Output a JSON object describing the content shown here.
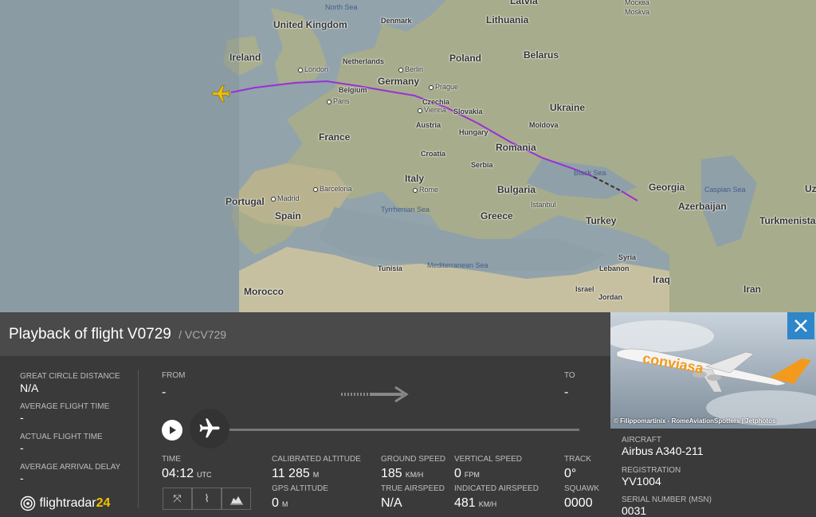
{
  "map": {
    "countries": [
      "United Kingdom",
      "Ireland",
      "France",
      "Portugal",
      "Spain",
      "Morocco",
      "Netherlands",
      "Belgium",
      "Germany",
      "Denmark",
      "Poland",
      "Czechia",
      "Austria",
      "Slovakia",
      "Hungary",
      "Croatia",
      "Serbia",
      "Italy",
      "Romania",
      "Bulgaria",
      "Moldova",
      "Ukraine",
      "Belarus",
      "Lithuania",
      "Latvia",
      "Greece",
      "Turkey",
      "Georgia",
      "Azerbaijan",
      "Turkmenista",
      "Syria",
      "Lebanon",
      "Israel",
      "Jordan",
      "Iraq",
      "Iran",
      "Tunisia",
      "Uz"
    ],
    "cities": [
      "London",
      "Paris",
      "Berlin",
      "Prague",
      "Vienna",
      "Madrid",
      "Barcelona",
      "Rome",
      "Istanbul",
      "Moskva"
    ],
    "city_sub": {
      "Moskva": "Москва"
    },
    "seas": [
      "North Sea",
      "Black Sea",
      "Caspian Sea",
      "Tyrrhenian Sea",
      "Mediterranean Sea"
    ]
  },
  "flight": {
    "title_prefix": "Playback of flight",
    "flight_number": "V0729",
    "callsign": "/ VCV729"
  },
  "stats": {
    "great_circle_distance_label": "GREAT CIRCLE DISTANCE",
    "great_circle_distance": "N/A",
    "average_flight_time_label": "AVERAGE FLIGHT TIME",
    "average_flight_time": "-",
    "actual_flight_time_label": "ACTUAL FLIGHT TIME",
    "actual_flight_time": "-",
    "average_arrival_delay_label": "AVERAGE ARRIVAL DELAY",
    "average_arrival_delay": "-"
  },
  "route": {
    "from_label": "FROM",
    "from": "-",
    "to_label": "TO",
    "to": "-"
  },
  "telemetry": {
    "time_label": "TIME",
    "time": "04:12",
    "time_unit": "UTC",
    "cal_alt_label": "CALIBRATED ALTITUDE",
    "cal_alt": "11 285",
    "cal_alt_unit": "M",
    "gps_alt_label": "GPS ALTITUDE",
    "gps_alt": "0",
    "gps_alt_unit": "M",
    "ground_speed_label": "GROUND SPEED",
    "ground_speed": "185",
    "ground_speed_unit": "KM/H",
    "true_airspeed_label": "TRUE AIRSPEED",
    "true_airspeed": "N/A",
    "vertical_speed_label": "VERTICAL SPEED",
    "vertical_speed": "0",
    "vertical_speed_unit": "FPM",
    "indicated_airspeed_label": "INDICATED AIRSPEED",
    "indicated_airspeed": "481",
    "indicated_airspeed_unit": "KM/H",
    "track_label": "TRACK",
    "track": "0°",
    "squawk_label": "SQUAWK",
    "squawk": "0000"
  },
  "aircraft": {
    "photo_credit": "© Filippomartinix - RomeAviationSpotters | Jetphotos",
    "livery_text": "conviasa",
    "aircraft_label": "AIRCRAFT",
    "aircraft": "Airbus A340-211",
    "registration_label": "REGISTRATION",
    "registration": "YV1004",
    "serial_label": "SERIAL NUMBER (MSN)",
    "serial": "0031"
  },
  "brand": {
    "name_main": "flightradar",
    "name_num": "24"
  },
  "colors": {
    "track": "#9b2fd6",
    "plane": "#f2c200",
    "accent": "#2f86c9",
    "panel": "#3a3a3a"
  },
  "icons": [
    "play-icon",
    "airplane-icon",
    "arrow-right-icon",
    "fit-view-icon",
    "route-icon",
    "chart-icon",
    "close-icon",
    "flightradar-logo-icon"
  ]
}
